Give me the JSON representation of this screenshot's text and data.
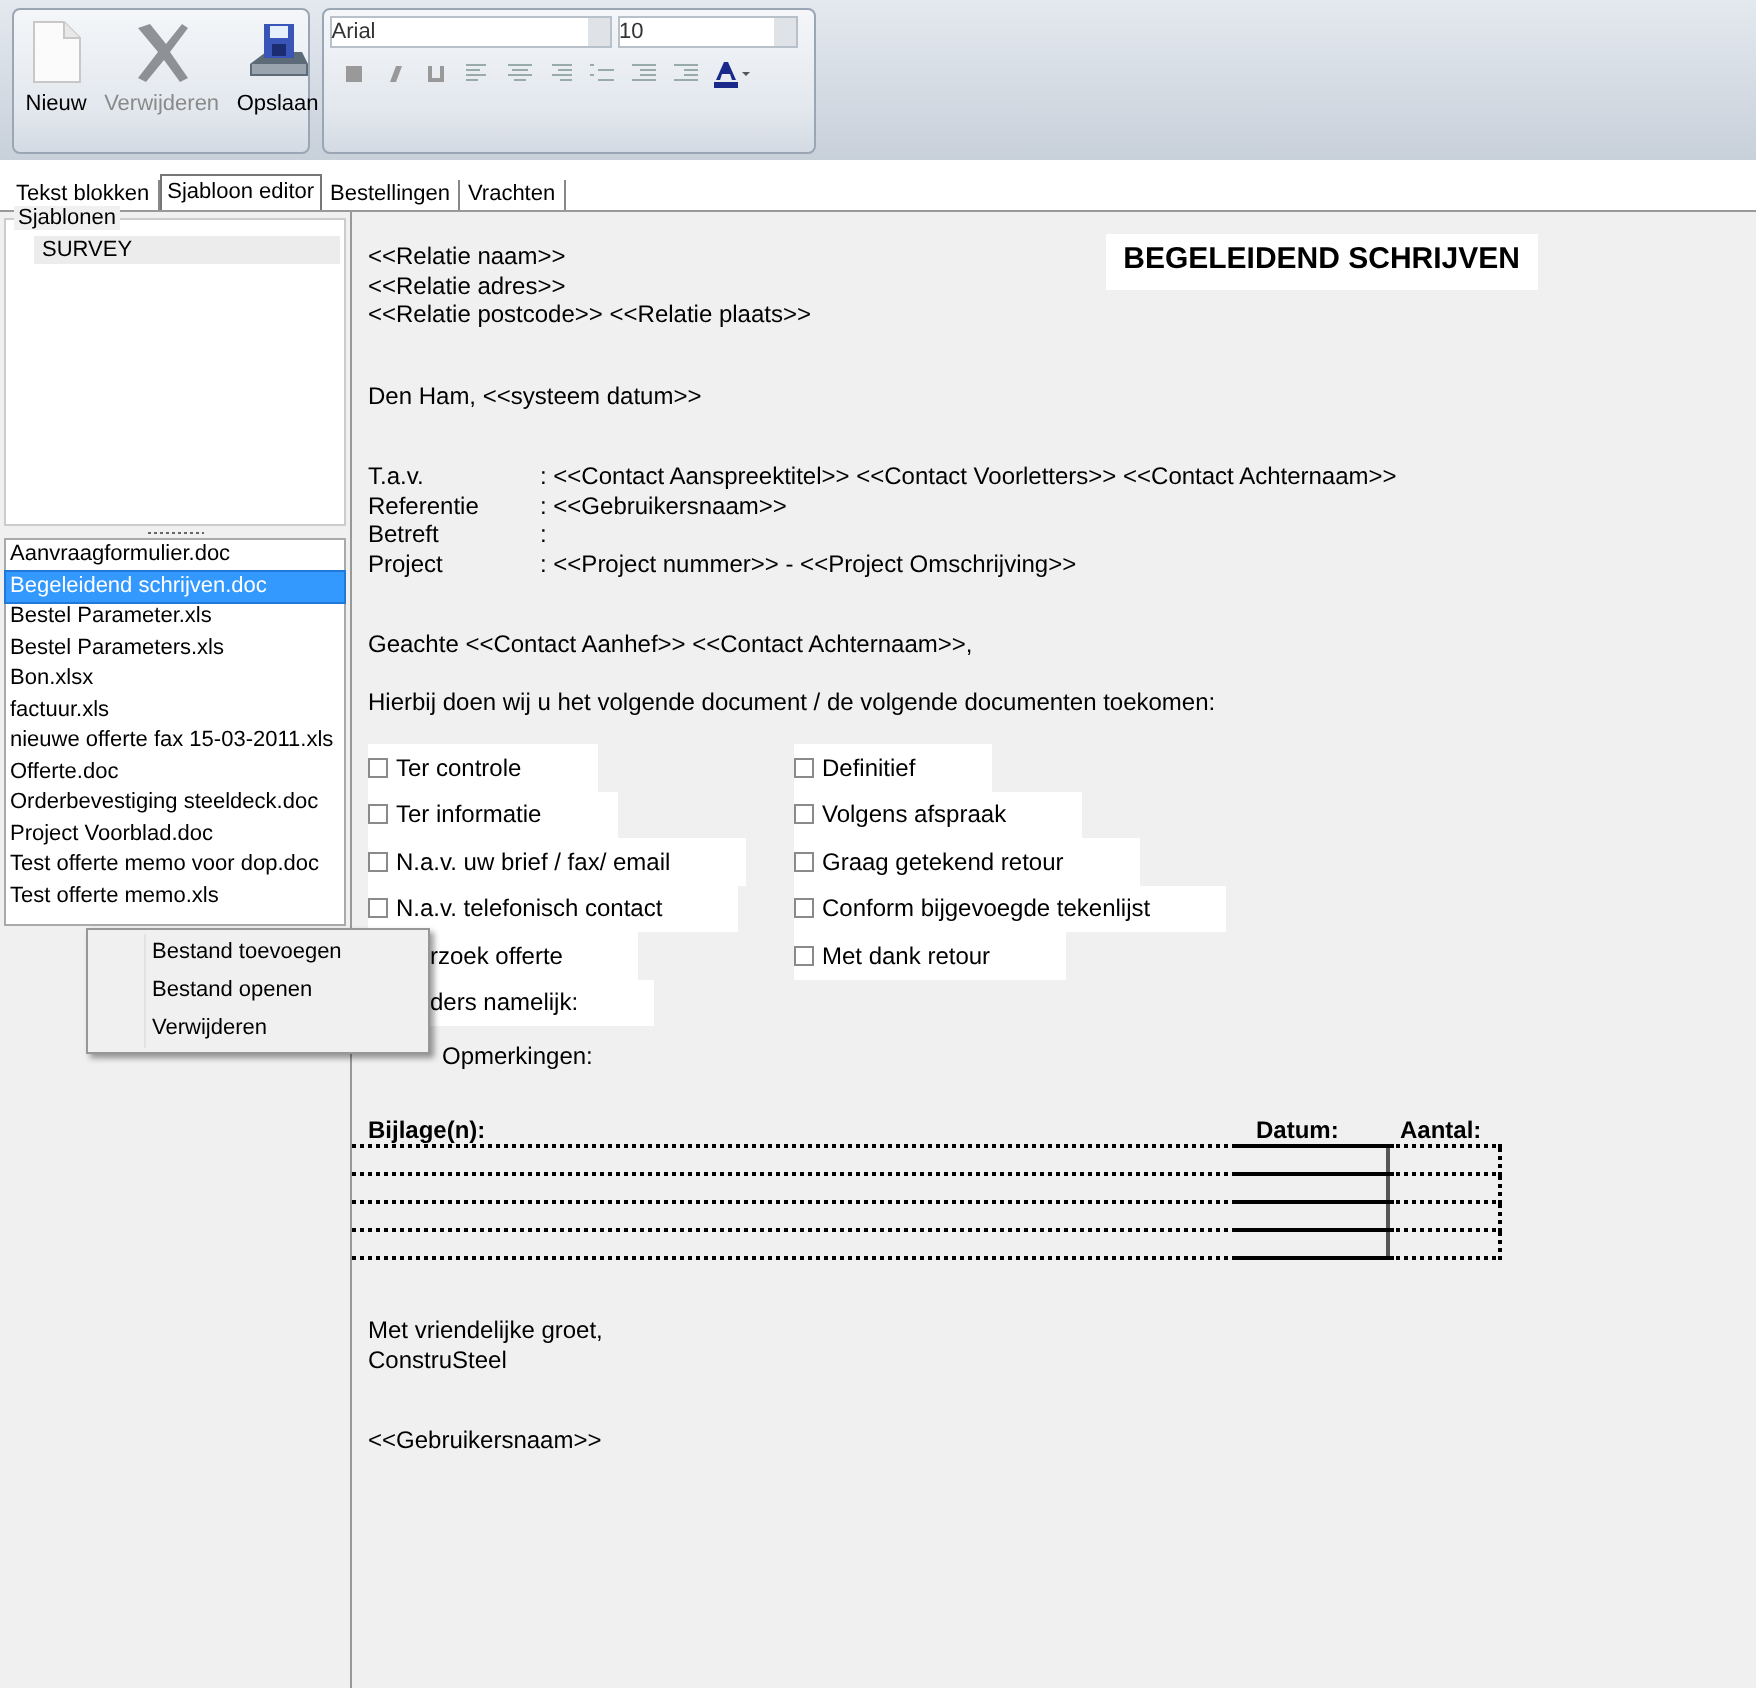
{
  "toolbar": {
    "file_buttons": [
      {
        "label": "Nieuw",
        "disabled": false
      },
      {
        "label": "Verwijderen",
        "disabled": true
      },
      {
        "label": "Opslaan",
        "disabled": false
      }
    ],
    "font": {
      "family": "Arial",
      "size": "10"
    }
  },
  "tabs": [
    {
      "label": "Tekst blokken",
      "selected": false
    },
    {
      "label": "Sjabloon editor",
      "selected": true
    },
    {
      "label": "Bestellingen",
      "selected": false
    },
    {
      "label": "Vrachten",
      "selected": false
    }
  ],
  "sidebar": {
    "group_title": "Sjablonen",
    "tree": [
      {
        "label": "SURVEY",
        "selected": true
      }
    ],
    "files": [
      {
        "label": "Aanvraagformulier.doc",
        "selected": false
      },
      {
        "label": "Begeleidend schrijven.doc",
        "selected": true
      },
      {
        "label": "Bestel Parameter.xls",
        "selected": false
      },
      {
        "label": "Bestel Parameters.xls",
        "selected": false
      },
      {
        "label": "Bon.xlsx",
        "selected": false
      },
      {
        "label": "factuur.xls",
        "selected": false
      },
      {
        "label": "nieuwe offerte fax 15-03-2011.xls",
        "selected": false
      },
      {
        "label": "Offerte.doc",
        "selected": false
      },
      {
        "label": "Orderbevestiging steeldeck.doc",
        "selected": false
      },
      {
        "label": "Project Voorblad.doc",
        "selected": false
      },
      {
        "label": "Test offerte memo voor dop.doc",
        "selected": false
      },
      {
        "label": "Test offerte memo.xls",
        "selected": false
      }
    ]
  },
  "context_menu": {
    "items": [
      "Bestand toevoegen",
      "Bestand openen",
      "Verwijderen"
    ]
  },
  "document": {
    "title": "BEGELEIDEND SCHRIJVEN",
    "address_lines": [
      "<<Relatie naam>>",
      "<<Relatie adres>>",
      "<<Relatie postcode>>  <<Relatie plaats>>"
    ],
    "place_date": "Den Ham, <<systeem datum>>",
    "fields": [
      {
        "label": "T.a.v.",
        "value": ": <<Contact Aanspreektitel>> <<Contact Voorletters>> <<Contact Achternaam>>"
      },
      {
        "label": "Referentie",
        "value": ": <<Gebruikersnaam>>"
      },
      {
        "label": "Betreft",
        "value": ":"
      },
      {
        "label": "Project",
        "value": ": <<Project nummer>> - <<Project Omschrijving>>"
      }
    ],
    "salutation": "Geachte <<Contact Aanhef>> <<Contact Achternaam>>,",
    "intro": "Hierbij doen wij u het volgende document / de volgende documenten toekomen:",
    "options_column_1": [
      {
        "label": "Ter controle",
        "checked": false
      },
      {
        "label": "Ter informatie",
        "checked": false
      },
      {
        "label": "N.a.v. uw brief / fax/ email",
        "checked": false
      },
      {
        "label": "N.a.v. telefonisch contact",
        "checked": false
      },
      {
        "label": "rzoek offerte"
      },
      {
        "label": "ders namelijk:"
      }
    ],
    "options_column_2": [
      {
        "label": "Definitief",
        "checked": false
      },
      {
        "label": "Volgens afspraak",
        "checked": false
      },
      {
        "label": "Graag getekend retour",
        "checked": false
      },
      {
        "label": "Conform bijgevoegde tekenlijst",
        "checked": false
      },
      {
        "label": "Met dank retour",
        "checked": false
      }
    ],
    "remarks_label": "Opmerkingen:",
    "attachments": {
      "columns": [
        "Bijlage(n):",
        "Datum:",
        "Aantal:"
      ]
    },
    "closing_lines": [
      "Met vriendelijke groet,",
      "ConstruSteel"
    ],
    "signature": "<<Gebruikersnaam>>"
  }
}
